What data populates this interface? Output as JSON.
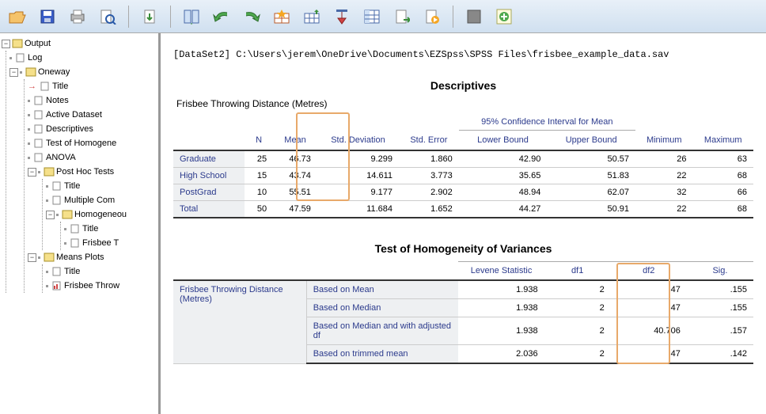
{
  "toolbar_icons": [
    "open",
    "save",
    "print",
    "preview",
    "export",
    "pivot",
    "undo",
    "redo",
    "star-table",
    "grid-up",
    "dl-arrow",
    "sel-cols",
    "page-arrow",
    "play-doc",
    "block",
    "plus-green"
  ],
  "tree": {
    "root": "Output",
    "log": "Log",
    "oneway": "Oneway",
    "title": "Title",
    "notes": "Notes",
    "active_dataset": "Active Dataset",
    "descriptives": "Descriptives",
    "test_homog": "Test of Homogene",
    "anova": "ANOVA",
    "posthoc": "Post Hoc Tests",
    "posthoc_title": "Title",
    "multiple_comp": "Multiple Com",
    "homogeneous": "Homogeneou",
    "homog_title": "Title",
    "frisbee_t": "Frisbee T",
    "means_plots": "Means Plots",
    "means_title": "Title",
    "frisbee_throw": "Frisbee Throw"
  },
  "path": "[DataSet2] C:\\Users\\jerem\\OneDrive\\Documents\\EZSpss\\SPSS Files\\frisbee_example_data.sav",
  "desc": {
    "title": "Descriptives",
    "subtitle": "Frisbee Throwing Distance (Metres)",
    "ci_header": "95% Confidence Interval for Mean",
    "cols": {
      "n": "N",
      "mean": "Mean",
      "sd": "Std. Deviation",
      "se": "Std. Error",
      "lb": "Lower Bound",
      "ub": "Upper Bound",
      "min": "Minimum",
      "max": "Maximum"
    },
    "rows": [
      {
        "label": "Graduate",
        "n": 25,
        "mean": "46.73",
        "sd": "9.299",
        "se": "1.860",
        "lb": "42.90",
        "ub": "50.57",
        "min": 26,
        "max": 63
      },
      {
        "label": "High School",
        "n": 15,
        "mean": "43.74",
        "sd": "14.611",
        "se": "3.773",
        "lb": "35.65",
        "ub": "51.83",
        "min": 22,
        "max": 68
      },
      {
        "label": "PostGrad",
        "n": 10,
        "mean": "55.51",
        "sd": "9.177",
        "se": "2.902",
        "lb": "48.94",
        "ub": "62.07",
        "min": 32,
        "max": 66
      },
      {
        "label": "Total",
        "n": 50,
        "mean": "47.59",
        "sd": "11.684",
        "se": "1.652",
        "lb": "44.27",
        "ub": "50.91",
        "min": 22,
        "max": 68
      }
    ]
  },
  "levene": {
    "title": "Test of Homogeneity of Variances",
    "group_label": "Frisbee Throwing Distance (Metres)",
    "cols": {
      "stat": "Levene Statistic",
      "df1": "df1",
      "df2": "df2",
      "sig": "Sig."
    },
    "rows": [
      {
        "label": "Based on Mean",
        "stat": "1.938",
        "df1": "2",
        "df2": "47",
        "sig": ".155"
      },
      {
        "label": "Based on Median",
        "stat": "1.938",
        "df1": "2",
        "df2": "47",
        "sig": ".155"
      },
      {
        "label": "Based on Median and with adjusted df",
        "stat": "1.938",
        "df1": "2",
        "df2": "40.706",
        "sig": ".157"
      },
      {
        "label": "Based on trimmed mean",
        "stat": "2.036",
        "df1": "2",
        "df2": "47",
        "sig": ".142"
      }
    ]
  }
}
